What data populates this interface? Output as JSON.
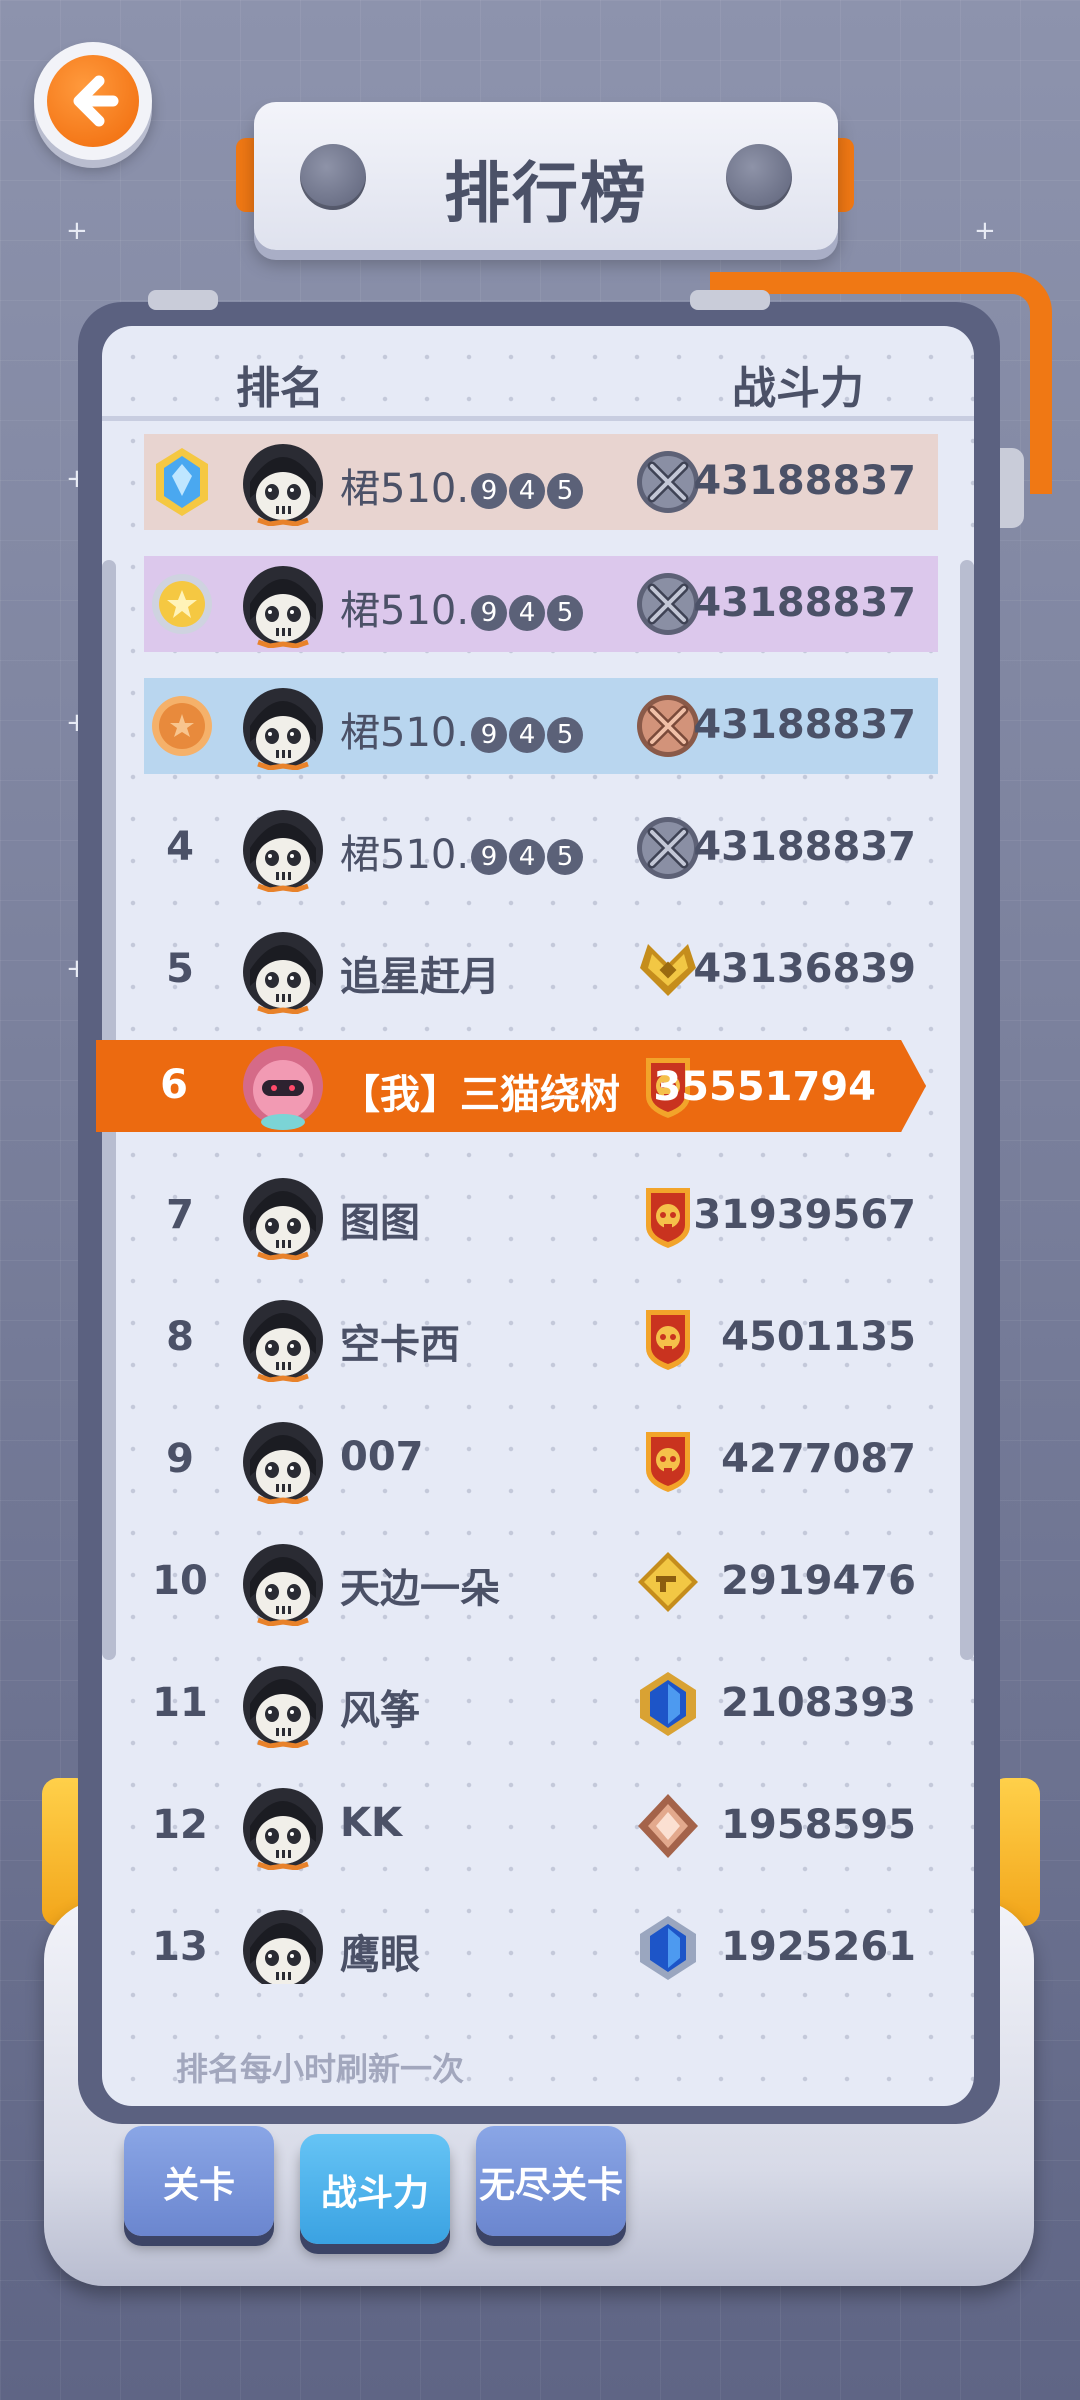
{
  "header": {
    "title": "排行榜"
  },
  "columns": {
    "rank": "排名",
    "power": "战斗力"
  },
  "rows": [
    {
      "rank": "",
      "name": "桾510.",
      "suffix": [
        "9",
        "4",
        "5"
      ],
      "power": "43188837"
    },
    {
      "rank": "",
      "name": "桾510.",
      "suffix": [
        "9",
        "4",
        "5"
      ],
      "power": "43188837"
    },
    {
      "rank": "",
      "name": "桾510.",
      "suffix": [
        "9",
        "4",
        "5"
      ],
      "power": "43188837"
    },
    {
      "rank": "4",
      "name": "桾510.",
      "suffix": [
        "9",
        "4",
        "5"
      ],
      "power": "43188837"
    },
    {
      "rank": "5",
      "name": "追星赶月",
      "power": "43136839"
    },
    {
      "rank": "6",
      "name": "【我】三猫绕树",
      "power": "35551794"
    },
    {
      "rank": "7",
      "name": "图图",
      "power": "31939567"
    },
    {
      "rank": "8",
      "name": "空卡西",
      "power": "4501135"
    },
    {
      "rank": "9",
      "name": "007",
      "power": "4277087"
    },
    {
      "rank": "10",
      "name": "天边一朵",
      "power": "2919476"
    },
    {
      "rank": "11",
      "name": "风筝",
      "power": "2108393"
    },
    {
      "rank": "12",
      "name": "KK",
      "power": "1958595"
    },
    {
      "rank": "13",
      "name": "鹰眼",
      "power": "1925261"
    }
  ],
  "footnote": "排名每小时刷新一次",
  "tabs": [
    {
      "label": "关卡",
      "active": false
    },
    {
      "label": "战斗力",
      "active": true
    },
    {
      "label": "无尽关卡",
      "active": false
    }
  ],
  "colors": {
    "accent": "#ec6a10",
    "row1": "#e8d4d0",
    "row2": "#dcc8ec",
    "row3": "#b9d6ef",
    "text": "#4b5167"
  }
}
